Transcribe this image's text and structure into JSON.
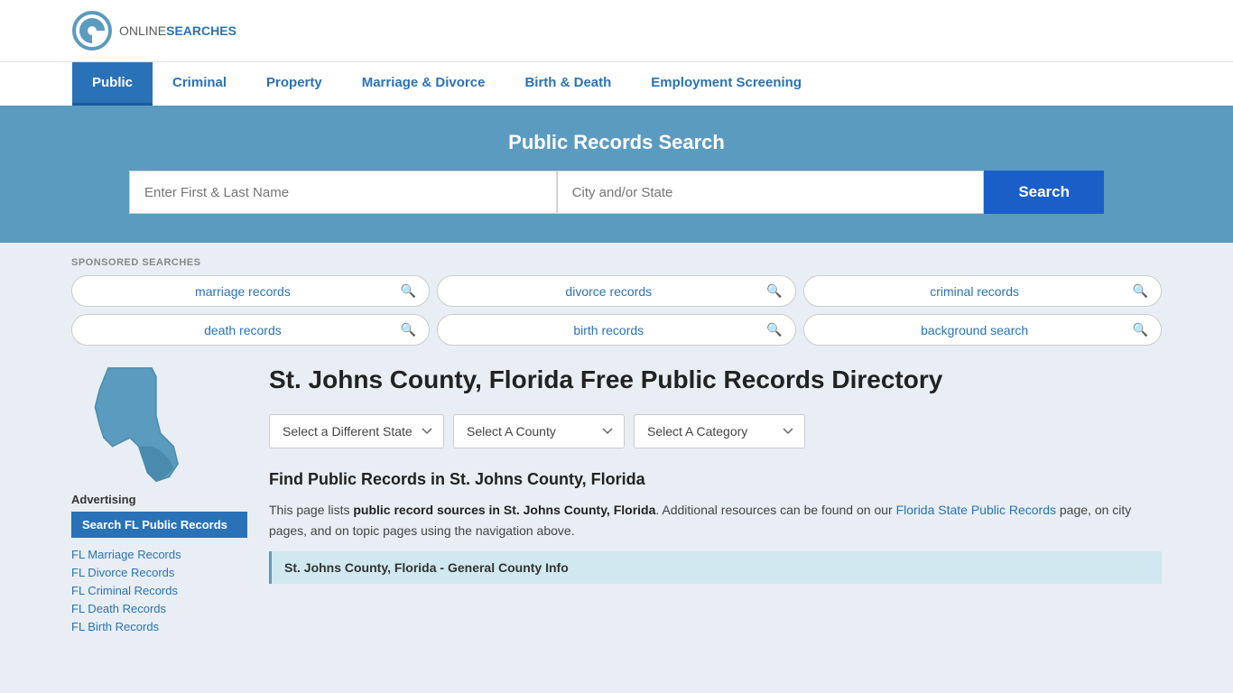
{
  "site": {
    "logo_online": "ONLINE",
    "logo_searches": "SEARCHES"
  },
  "nav": {
    "items": [
      {
        "label": "Public",
        "active": true
      },
      {
        "label": "Criminal",
        "active": false
      },
      {
        "label": "Property",
        "active": false
      },
      {
        "label": "Marriage & Divorce",
        "active": false
      },
      {
        "label": "Birth & Death",
        "active": false
      },
      {
        "label": "Employment Screening",
        "active": false
      }
    ]
  },
  "hero": {
    "title": "Public Records Search",
    "name_placeholder": "Enter First & Last Name",
    "location_placeholder": "City and/or State",
    "search_button": "Search"
  },
  "sponsored": {
    "label": "SPONSORED SEARCHES",
    "pills": [
      {
        "text": "marriage records"
      },
      {
        "text": "divorce records"
      },
      {
        "text": "criminal records"
      },
      {
        "text": "death records"
      },
      {
        "text": "birth records"
      },
      {
        "text": "background search"
      }
    ]
  },
  "sidebar": {
    "advertising_label": "Advertising",
    "ad_button": "Search FL Public Records",
    "links": [
      {
        "text": "FL Marriage Records"
      },
      {
        "text": "FL Divorce Records"
      },
      {
        "text": "FL Criminal Records"
      },
      {
        "text": "FL Death Records"
      },
      {
        "text": "FL Birth Records"
      }
    ]
  },
  "county_page": {
    "heading": "St. Johns County, Florida Free Public Records Directory",
    "dropdowns": {
      "state": "Select a Different State",
      "county": "Select A County",
      "category": "Select A Category"
    },
    "find_heading": "Find Public Records in St. Johns County, Florida",
    "find_description_part1": "This page lists ",
    "find_description_bold": "public record sources in St. Johns County, Florida",
    "find_description_part2": ". Additional resources can be found on our ",
    "find_description_link": "Florida State Public Records",
    "find_description_part3": " page, on city pages, and on topic pages using the navigation above.",
    "general_info_label": "St. Johns County, Florida - General County Info"
  }
}
